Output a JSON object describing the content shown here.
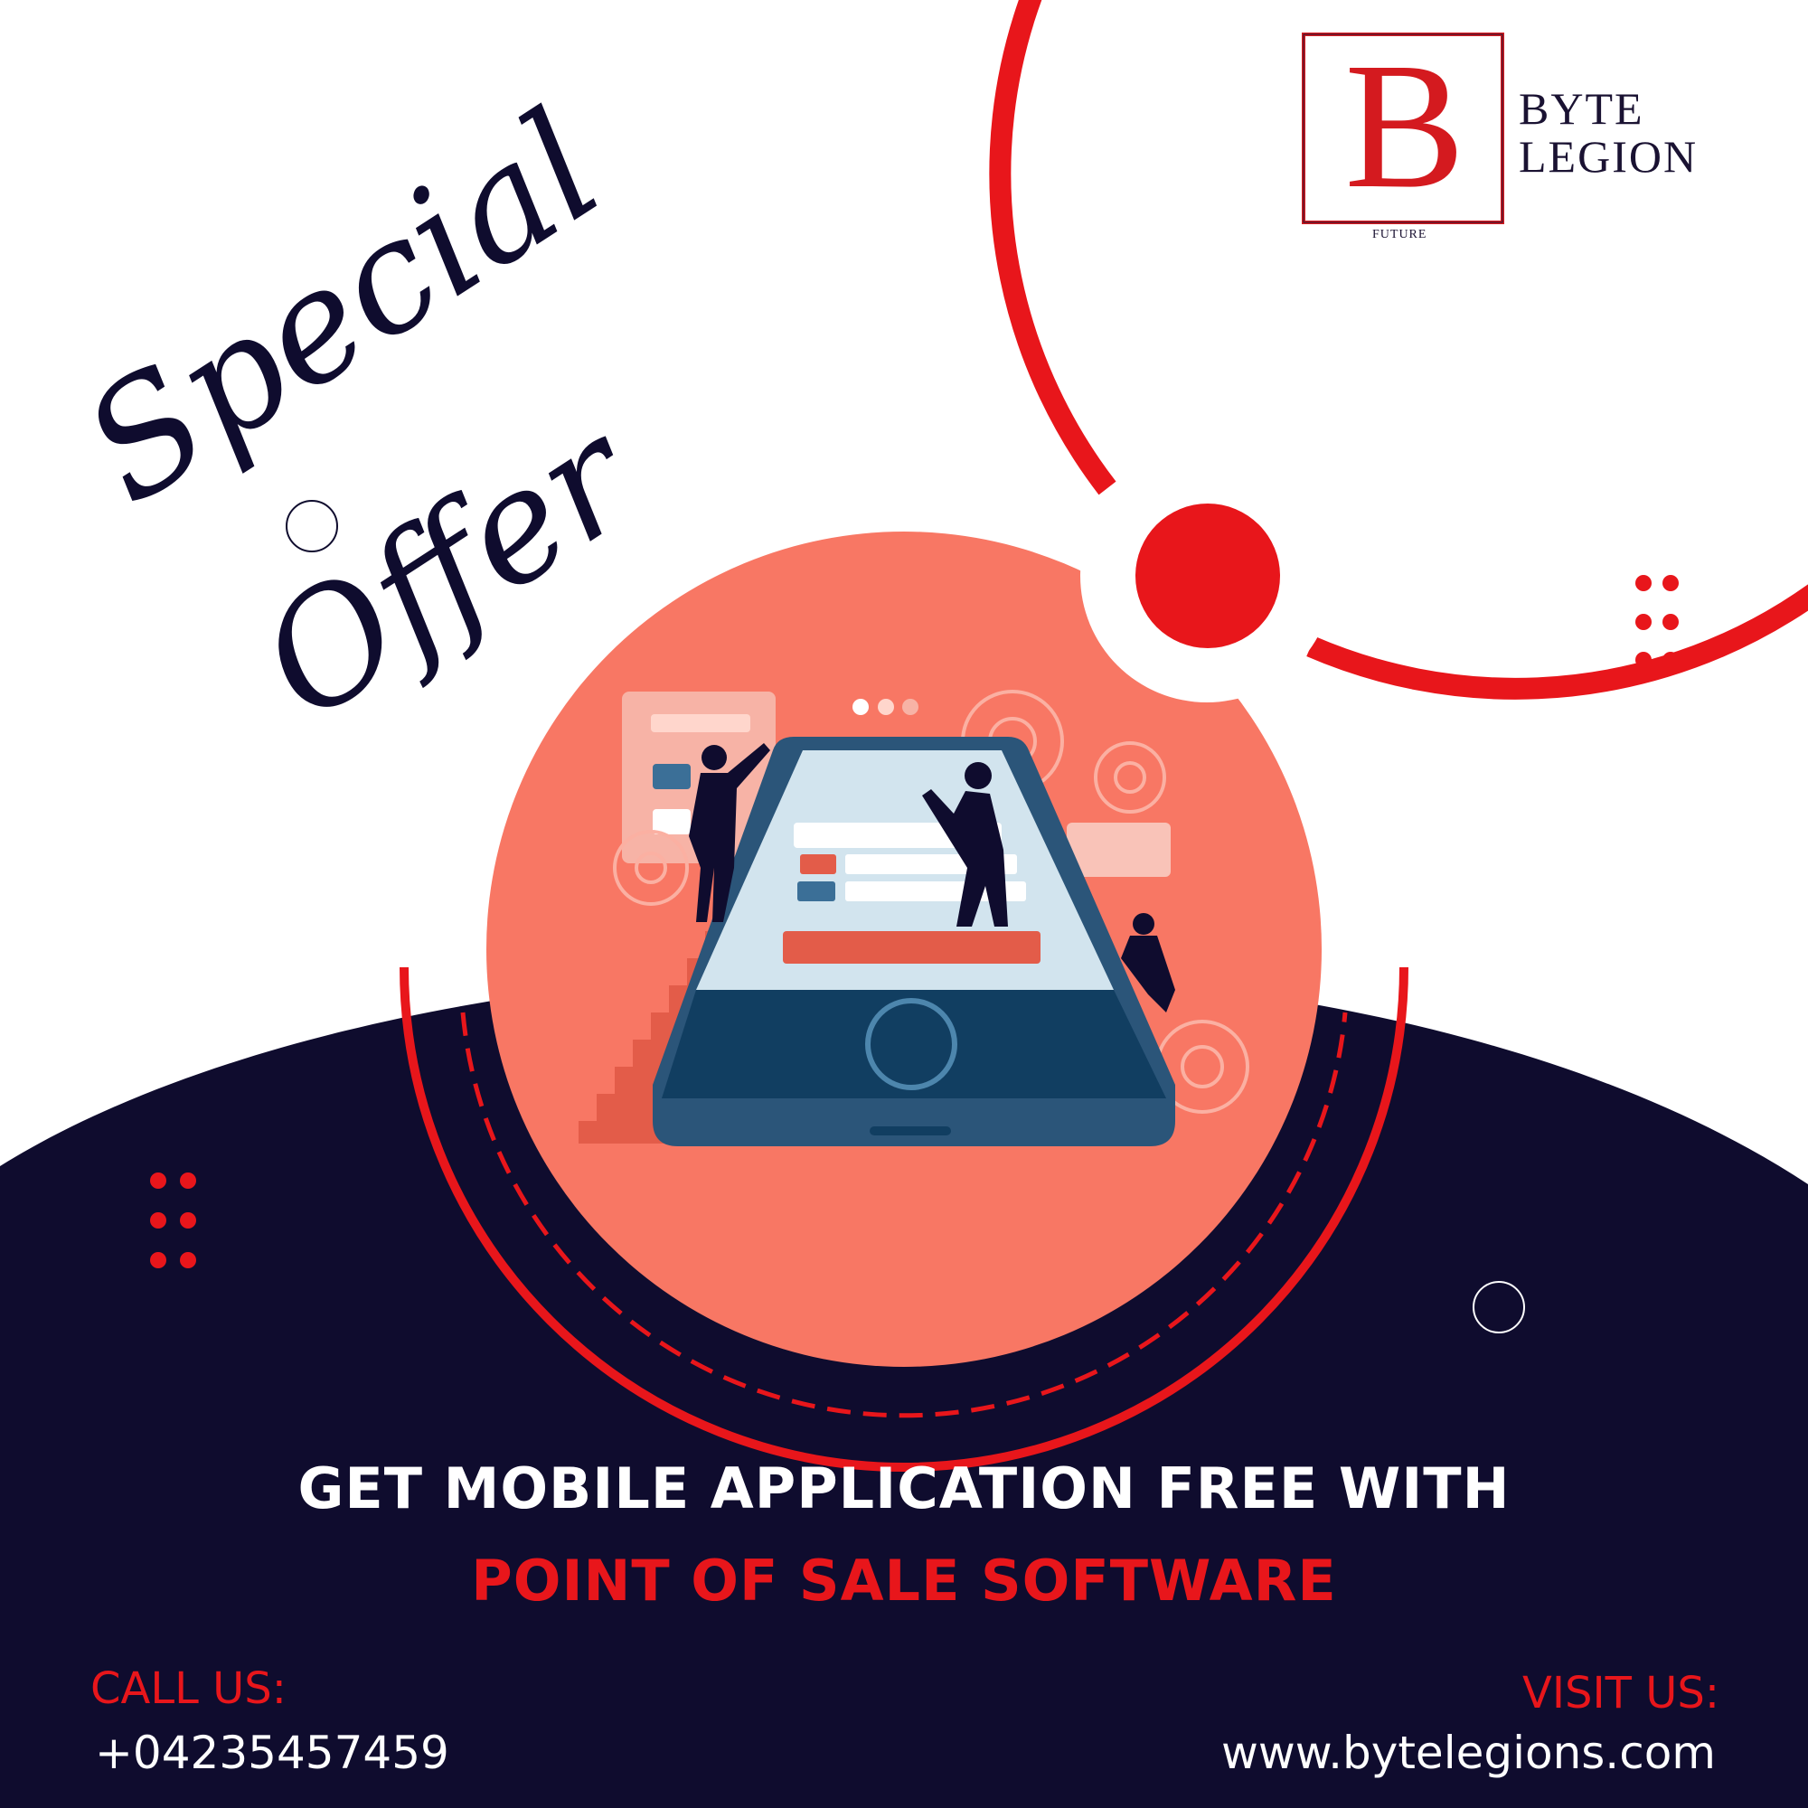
{
  "brand": {
    "logo_letter": "B",
    "line1": "BYTE",
    "line2": "LEGION",
    "tagline": "FUTURE",
    "colors": {
      "red": "#e8161b",
      "navy": "#0f0c2e",
      "coral": "#f87764"
    }
  },
  "promo": {
    "script_line1": "Special",
    "script_line2": "Offer",
    "headline_line1": "GET MOBILE APPLICATION FREE WITH",
    "headline_line2": "POINT OF SALE SOFTWARE"
  },
  "contact": {
    "call_label": "CALL US:",
    "phone": "+04235457459",
    "visit_label": "VISIT US:",
    "website": "www.bytelegions.com"
  },
  "icons": [
    "decorative-dots-icon",
    "ring-icon",
    "phone-illustration",
    "gear-icon"
  ]
}
